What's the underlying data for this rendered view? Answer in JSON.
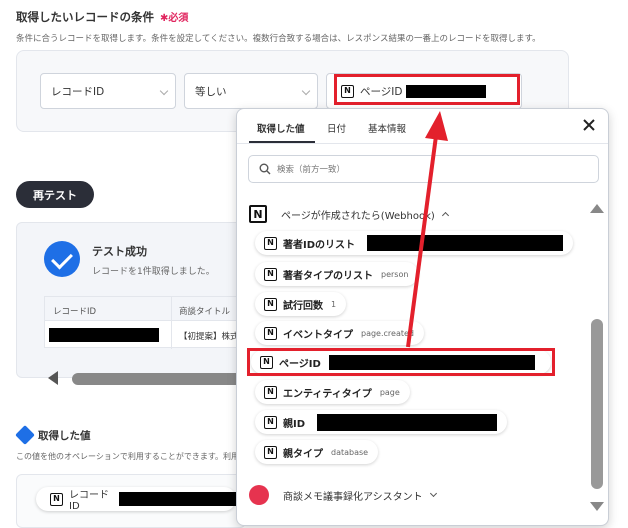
{
  "section": {
    "title": "取得したいレコードの条件",
    "required": "必須",
    "description": "条件に合うレコードを取得します。条件を設定してください。複数行合致する場合は、レスポンス結果の一番上のレコードを取得します。"
  },
  "condition": {
    "field": "レコードID",
    "operator": "等しい",
    "value_label": "ページID"
  },
  "retest_label": "再テスト",
  "test_result": {
    "title": "テスト成功",
    "message": "レコードを1件取得しました。",
    "columns": [
      "レコードID",
      "商談タイトル"
    ],
    "row_title_prefix": "【初提案】株式"
  },
  "acquired": {
    "title": "取得した値",
    "description": "この値を他のオペレーションで利用することができます。利用",
    "first_item": "レコードID"
  },
  "popup": {
    "tabs": [
      "取得した値",
      "日付",
      "基本情報"
    ],
    "search_placeholder": "検索（前方一致）",
    "group_title": "ページが作成されたら(Webhook)",
    "items": [
      {
        "label": "著者IDのリスト",
        "value": ""
      },
      {
        "label": "著者タイプのリスト",
        "value": "person"
      },
      {
        "label": "試行回数",
        "value": "1"
      },
      {
        "label": "イベントタイプ",
        "value": "page.created"
      },
      {
        "label": "ページID",
        "value": ""
      },
      {
        "label": "エンティティタイプ",
        "value": "page"
      },
      {
        "label": "親ID",
        "value": ""
      },
      {
        "label": "親タイプ",
        "value": "database"
      }
    ],
    "group2_title": "商談メモ議事録化アシスタント"
  },
  "colors": {
    "accent": "#1e6fe6",
    "highlight": "#e3202c",
    "dark": "#2b2e38"
  }
}
